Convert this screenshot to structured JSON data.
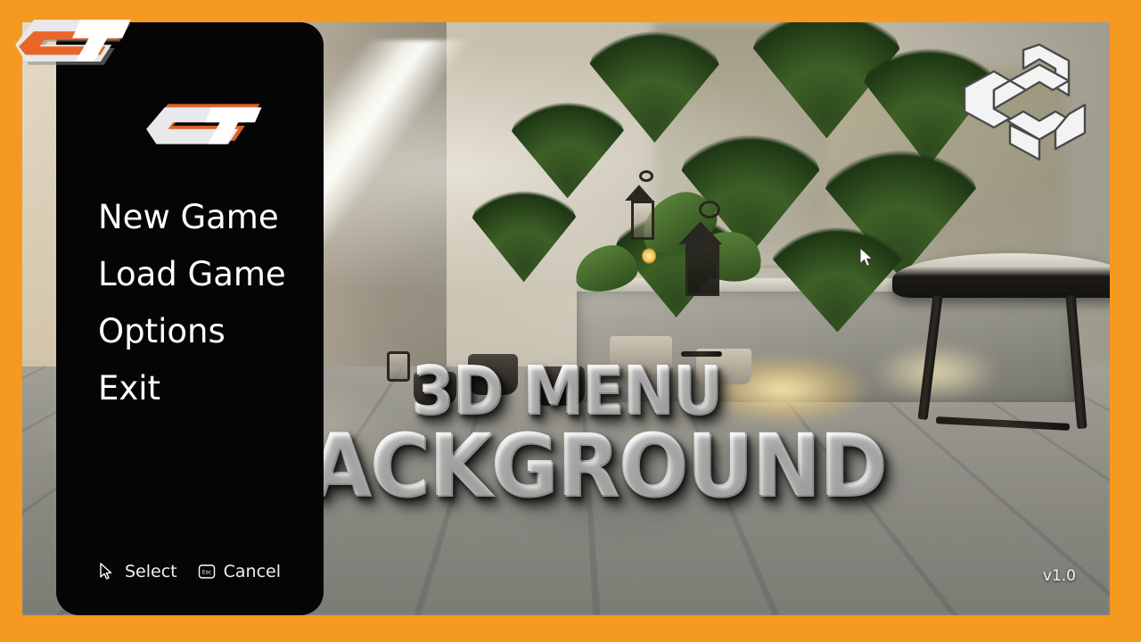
{
  "frame": {
    "border_color": "#F59920",
    "background_color": "#050505"
  },
  "brand": {
    "watermark_logo": "st-logo",
    "engine_logo": "unity-logo"
  },
  "menu": {
    "logo": "st-logo",
    "items": [
      {
        "id": "new-game",
        "label": "New Game"
      },
      {
        "id": "load-game",
        "label": "Load Game"
      },
      {
        "id": "options",
        "label": "Options"
      },
      {
        "id": "exit",
        "label": "Exit"
      }
    ],
    "hints": [
      {
        "icon": "mouse-pointer-icon",
        "label": "Select"
      },
      {
        "icon": "esc-key-icon",
        "label": "Cancel"
      }
    ]
  },
  "title": {
    "line1": "3D MENU",
    "line2": "BACKGROUND"
  },
  "status": {
    "version": "v1.0"
  },
  "scene": {
    "name": "3d-menu-background-scene",
    "cursor": "mouse-pointer-icon"
  }
}
